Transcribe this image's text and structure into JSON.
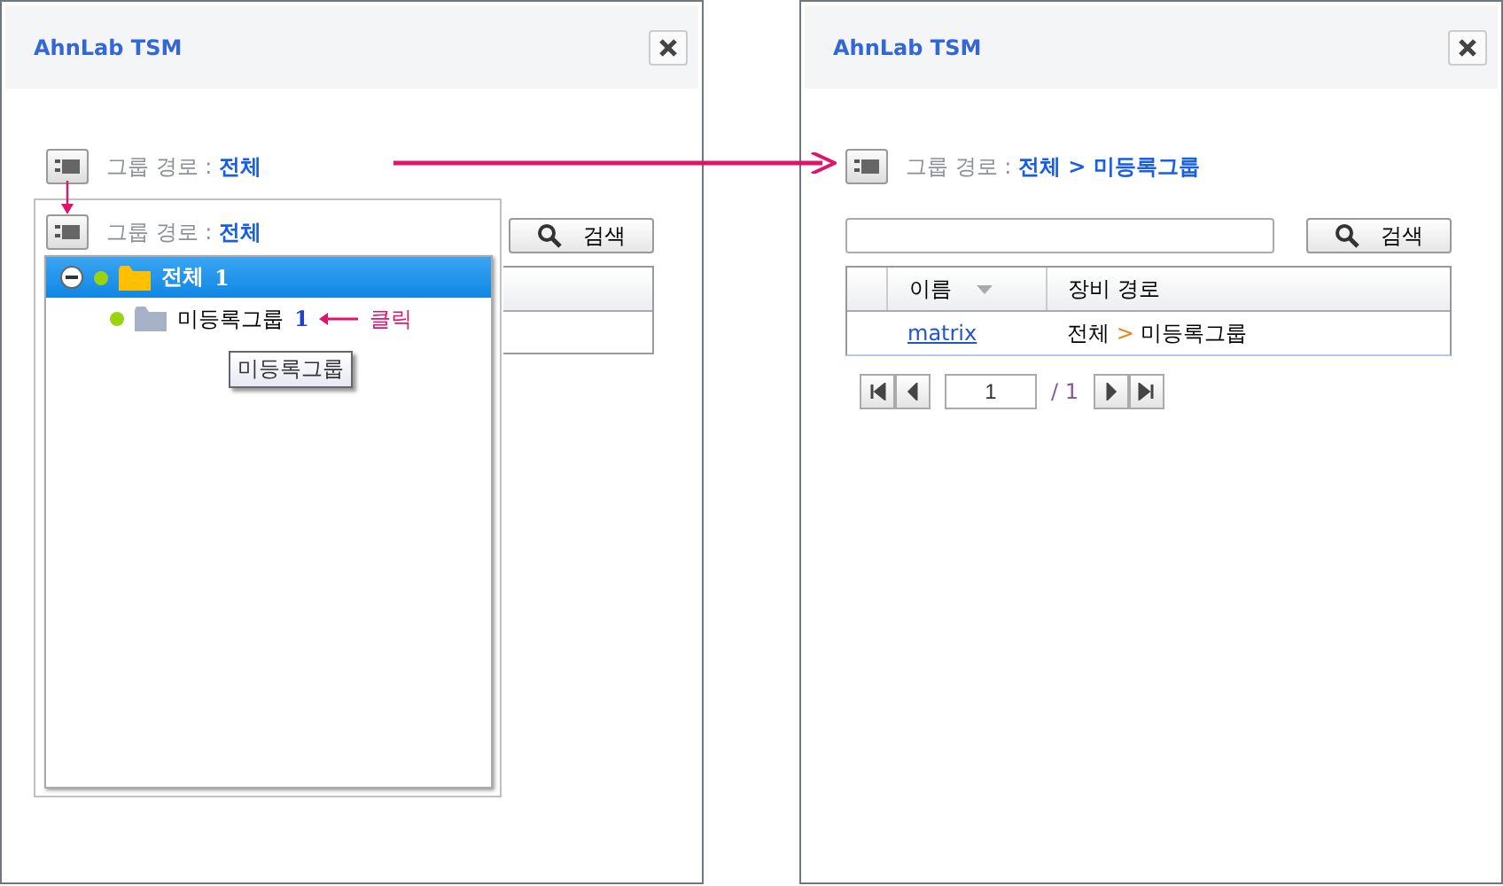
{
  "windows": [
    {
      "title": "AhnLab TSM",
      "path": {
        "label": "그룹 경로 :",
        "value": "전체"
      },
      "search_button": "검색",
      "dropdown": {
        "path": {
          "label": "그룹 경로 :",
          "value": "전체"
        },
        "tree": [
          {
            "label": "전체",
            "count": "1",
            "expanded": true,
            "selected": true,
            "children": [
              {
                "label": "미등록그룹",
                "count": "1",
                "selected": false,
                "annotation": "클릭"
              }
            ]
          }
        ],
        "tooltip": "미등록그룹"
      }
    },
    {
      "title": "AhnLab TSM",
      "path": {
        "label": "그룹 경로 :",
        "value": "전체 > 미등록그룹"
      },
      "search_button": "검색",
      "table": {
        "columns": [
          {
            "label": "이름",
            "sorted": true
          },
          {
            "label": "장비 경로",
            "sorted": false
          }
        ],
        "rows": [
          {
            "name": "matrix",
            "path": [
              "전체",
              "미등록그룹"
            ],
            "separator": ">"
          }
        ]
      },
      "pager": {
        "page": "1",
        "total": "/ 1"
      }
    }
  ]
}
